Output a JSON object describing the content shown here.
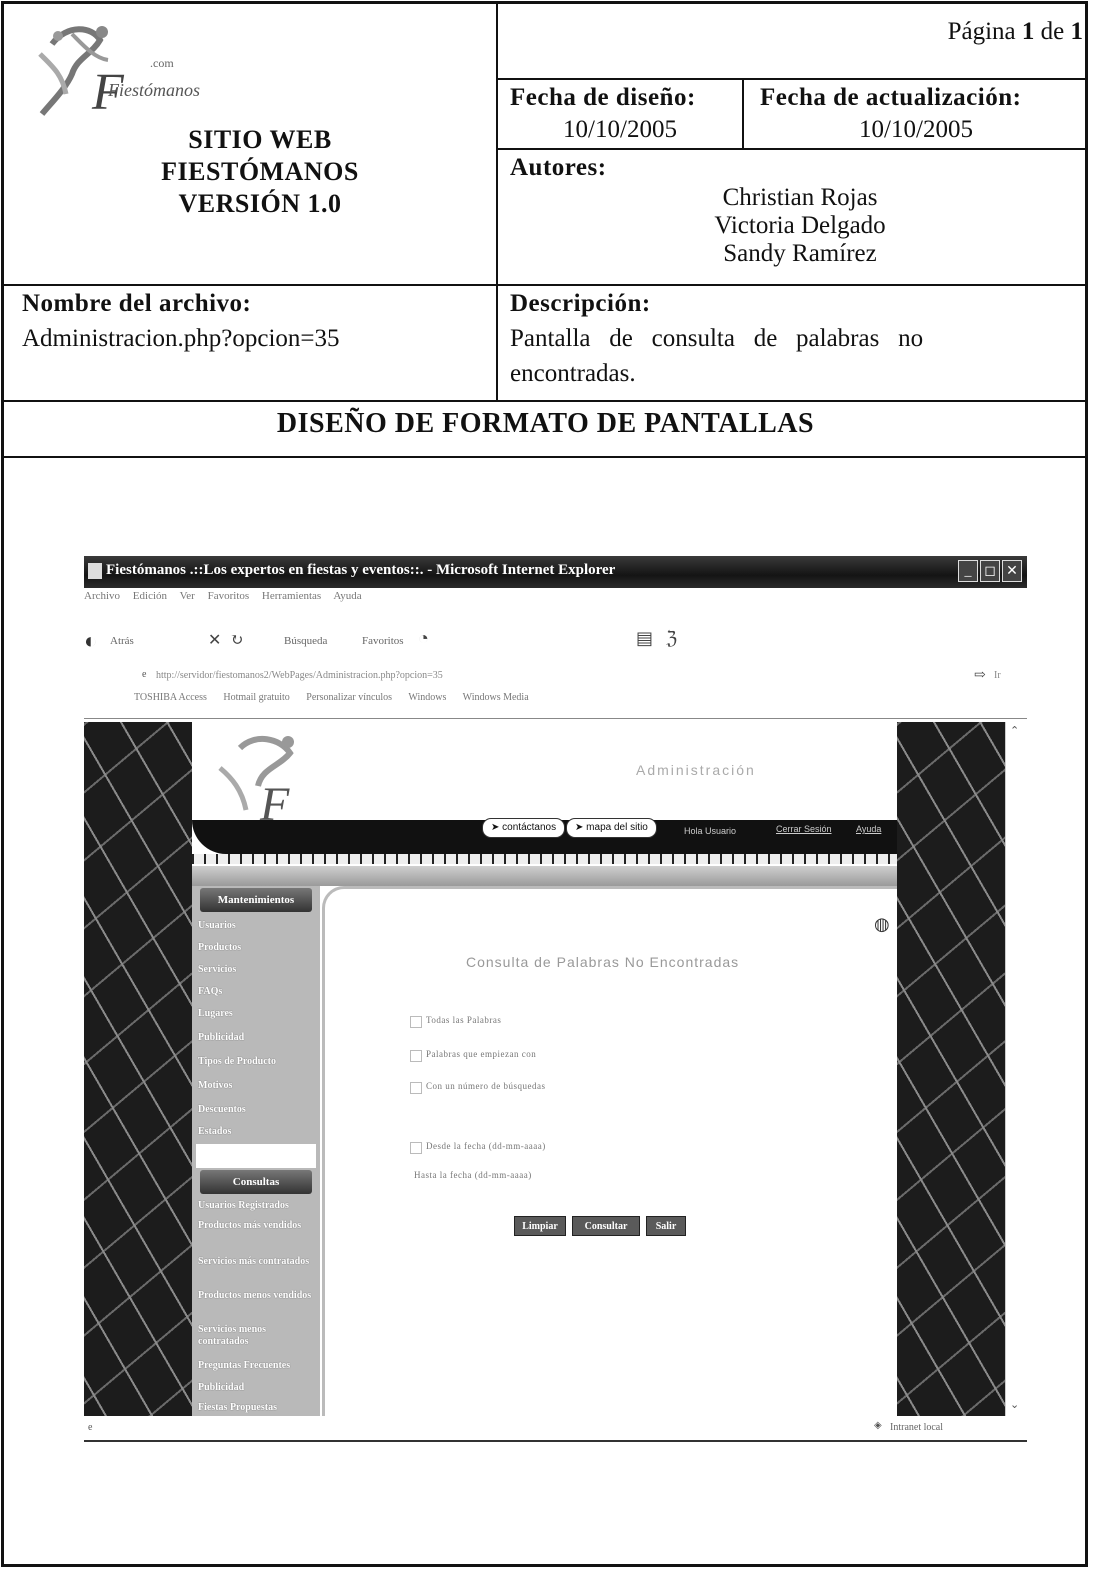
{
  "header": {
    "page_label": "Página",
    "page_current": "1",
    "page_of": "de",
    "page_total": "1",
    "site_title": [
      "SITIO WEB",
      "FIESTÓMANOS",
      "VERSIÓN 1.0"
    ],
    "logo_text": "Fiestómanos",
    "logo_com": ".com",
    "design_date_label": "Fecha de diseño:",
    "design_date": "10/10/2005",
    "update_date_label": "Fecha de actualización:",
    "update_date": "10/10/2005",
    "authors_label": "Autores:",
    "authors": [
      "Christian Rojas",
      "Victoria Delgado",
      "Sandy Ramírez"
    ],
    "file_label": "Nombre del archivo:",
    "file_name": "Administracion.php?opcion=35",
    "desc_label": "Descripción:",
    "desc_line1": "Pantalla   de   consulta   de   palabras   no",
    "desc_line2": "encontradas.",
    "section_title": "DISEÑO DE FORMATO DE PANTALLAS"
  },
  "browser": {
    "title": "Fiestómanos .::Los expertos en fiestas y eventos::. - Microsoft Internet Explorer",
    "menu": [
      "Archivo",
      "Edición",
      "Ver",
      "Favoritos",
      "Herramientas",
      "Ayuda"
    ],
    "toolbar": [
      "Atrás",
      "Búsqueda",
      "Favoritos"
    ],
    "address": "http://servidor/fiestomanos2/WebPages/Administracion.php?opcion=35",
    "go": "Ir",
    "links": [
      "TOSHIBA Access",
      "Hotmail gratuito",
      "Personalizar vínculos",
      "Windows",
      "Windows Media"
    ],
    "status_right": "Intranet local"
  },
  "site": {
    "admin_label": "Administración",
    "nav": [
      "contáctanos",
      "mapa del sitio"
    ],
    "greeting": "Hola Usuario",
    "logout": "Cerrar Sesión",
    "help": "Ayuda",
    "sidebar_maint_title": "Mantenimientos",
    "sidebar_maint": [
      "Usuarios",
      "Productos",
      "Servicios",
      "FAQs",
      "Lugares",
      "Publicidad",
      "Tipos de Producto",
      "Motivos",
      "Descuentos",
      "Estados"
    ],
    "sidebar_query_title": "Consultas",
    "sidebar_query": [
      "Usuarios Registrados",
      "Productos más vendidos",
      "Servicios más contratados",
      "Productos menos vendidos",
      "Servicios menos contratados",
      "Preguntas Frecuentes",
      "Publicidad",
      "Fiestas Propuestas"
    ],
    "page_heading": "Consulta de Palabras No Encontradas",
    "options": [
      "Todas las Palabras",
      "Palabras que empiezan con",
      "Con un número de búsquedas",
      "Desde la fecha (dd-mm-aaaa)",
      "Hasta la fecha (dd-mm-aaaa)"
    ],
    "buttons": [
      "Limpiar",
      "Consultar",
      "Salir"
    ]
  }
}
